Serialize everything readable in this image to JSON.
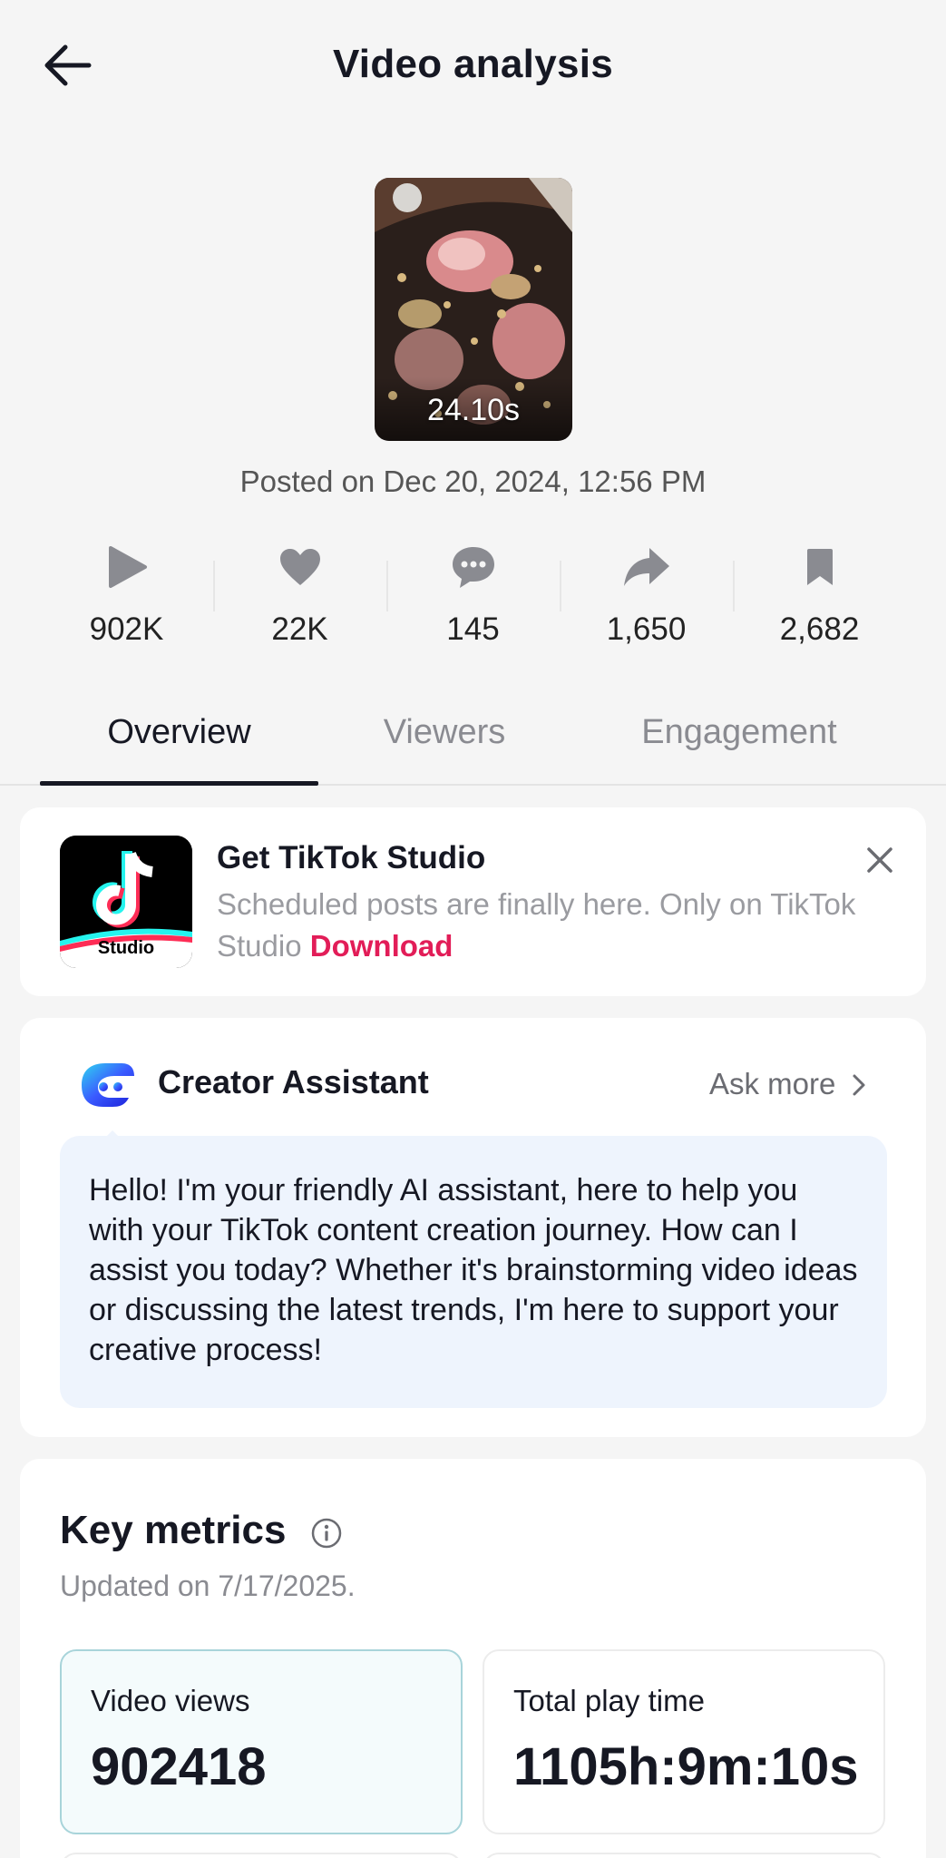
{
  "header": {
    "title": "Video analysis"
  },
  "video": {
    "duration": "24.10s",
    "posted": "Posted on Dec 20, 2024, 12:56 PM"
  },
  "stats": [
    {
      "icon": "play-icon",
      "value": "902K"
    },
    {
      "icon": "heart-icon",
      "value": "22K"
    },
    {
      "icon": "comment-icon",
      "value": "145"
    },
    {
      "icon": "share-icon",
      "value": "1,650"
    },
    {
      "icon": "bookmark-icon",
      "value": "2,682"
    }
  ],
  "tabs": [
    {
      "label": "Overview",
      "active": true
    },
    {
      "label": "Viewers",
      "active": false
    },
    {
      "label": "Engagement",
      "active": false
    }
  ],
  "studio_banner": {
    "logo_label": "Studio",
    "title": "Get TikTok Studio",
    "description": "Scheduled posts are finally here. Only on TikTok Studio",
    "link": "Download"
  },
  "assistant": {
    "title": "Creator Assistant",
    "ask_more": "Ask more",
    "message": "Hello! I'm your friendly AI assistant, here to help you with your TikTok content creation journey. How can I assist you today? Whether it's brainstorming video ideas or discussing the latest trends, I'm here to support your creative process!"
  },
  "metrics": {
    "title": "Key metrics",
    "updated": "Updated on 7/17/2025.",
    "items": [
      {
        "label": "Video views",
        "value": "902418"
      },
      {
        "label": "Total play time",
        "value": "1105h:9m:10s"
      }
    ]
  },
  "colors": {
    "accent": "#e21d58",
    "text": "#161823",
    "muted": "#8a8b91",
    "bubble": "#eef4fd"
  }
}
